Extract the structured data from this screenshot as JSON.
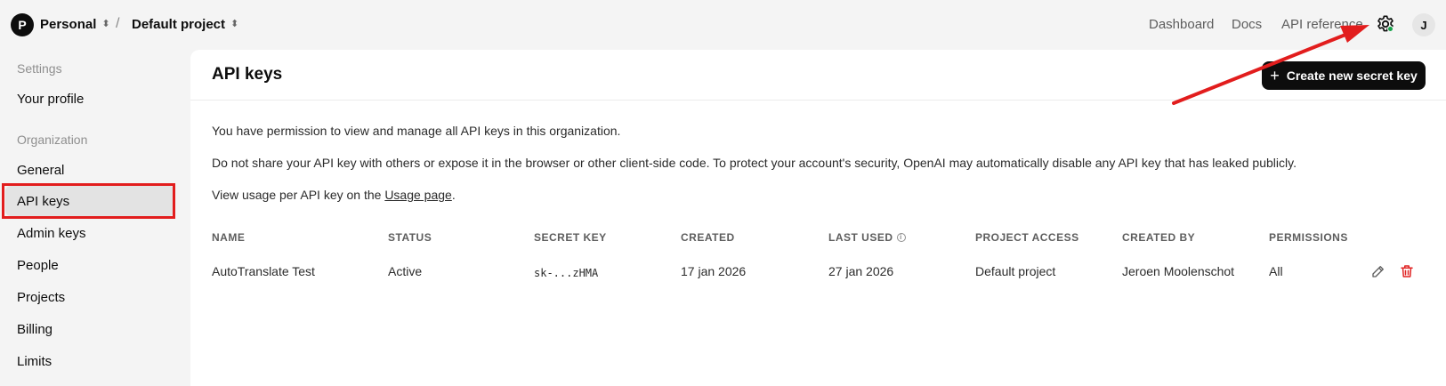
{
  "header": {
    "org_initial": "P",
    "org_name": "Personal",
    "separator": "/",
    "project_name": "Default project",
    "nav": [
      "Dashboard",
      "Docs",
      "API reference"
    ],
    "user_initial": "J"
  },
  "sidebar": {
    "settings_heading": "Settings",
    "your_profile": "Your profile",
    "organization_heading": "Organization",
    "items": [
      "General",
      "API keys",
      "Admin keys",
      "People",
      "Projects",
      "Billing",
      "Limits"
    ],
    "active_item": "API keys"
  },
  "main": {
    "title": "API keys",
    "create_button": "Create new secret key",
    "para1": "You have permission to view and manage all API keys in this organization.",
    "para2": "Do not share your API key with others or expose it in the browser or other client-side code. To protect your account's security, OpenAI may automatically disable any API key that has leaked publicly.",
    "para3_prefix": "View usage per API key on the ",
    "para3_link": "Usage page",
    "para3_suffix": "."
  },
  "table": {
    "columns": [
      "NAME",
      "STATUS",
      "SECRET KEY",
      "CREATED",
      "LAST USED",
      "PROJECT ACCESS",
      "CREATED BY",
      "PERMISSIONS"
    ],
    "rows": [
      {
        "name": "AutoTranslate Test",
        "status": "Active",
        "secret_key": "sk-...zHMA",
        "created": "17 jan 2026",
        "last_used": "27 jan 2026",
        "project_access": "Default project",
        "created_by": "Jeroen Moolenschot",
        "permissions": "All"
      }
    ]
  },
  "colors": {
    "annotation_red": "#e21d1d",
    "status_green": "#16a34a",
    "delete_red": "#e02424"
  }
}
